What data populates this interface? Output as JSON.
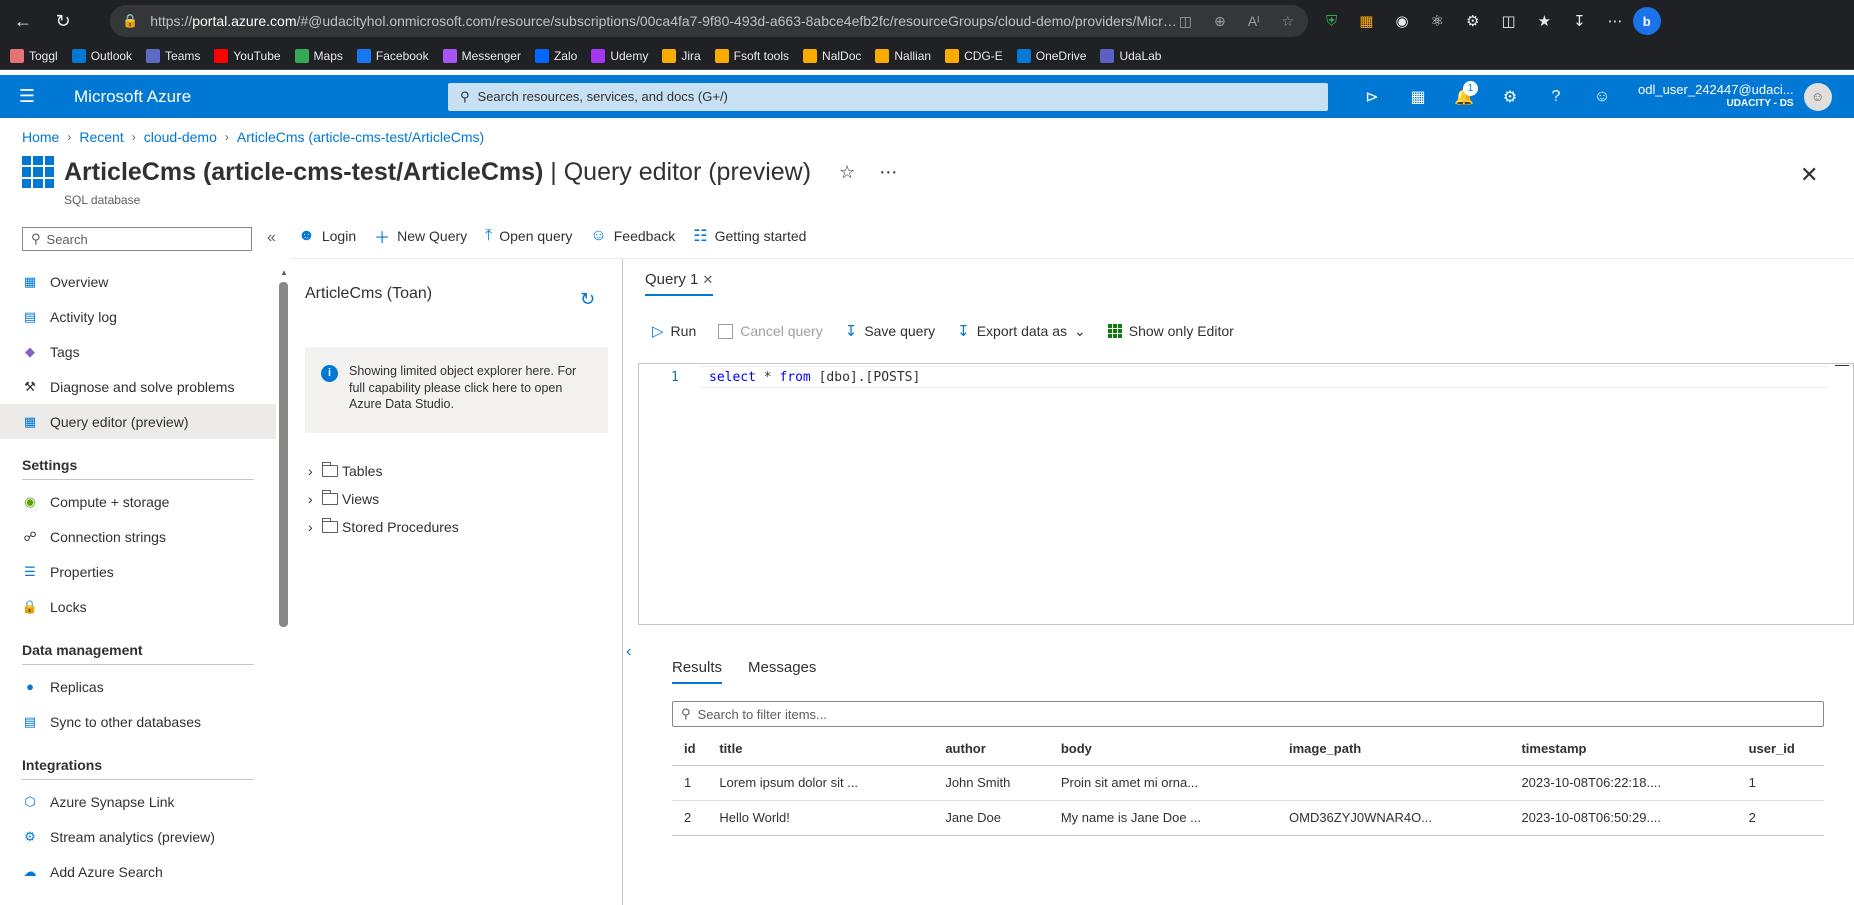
{
  "browser": {
    "url_prefix": "https://",
    "url_host": "portal.azure.com",
    "url_rest": "/#@udacityhol.onmicrosoft.com/resource/subscriptions/00ca4fa7-9f80-493d-a663-8abce4efb2fc/resourceGroups/cloud-demo/providers/Microsoft.Sql/...",
    "bookmarks": [
      "Toggl",
      "Outlook",
      "Teams",
      "YouTube",
      "Maps",
      "Facebook",
      "Messenger",
      "Zalo",
      "Udemy",
      "Jira",
      "Fsoft tools",
      "NalDoc",
      "Nallian",
      "CDG-E",
      "OneDrive",
      "UdaLab"
    ]
  },
  "azure": {
    "brand": "Microsoft Azure",
    "search_placeholder": "Search resources, services, and docs (G+/)",
    "notification_count": "1",
    "user_name": "odl_user_242447@udaci...",
    "user_org": "UDACITY - DS"
  },
  "breadcrumb": [
    "Home",
    "Recent",
    "cloud-demo",
    "ArticleCms (article-cms-test/ArticleCms)"
  ],
  "page": {
    "title_bold": "ArticleCms (article-cms-test/ArticleCms)",
    "title_light": " | Query editor (preview)",
    "subtitle": "SQL database"
  },
  "left_nav": {
    "search_placeholder": "Search",
    "items_top": [
      "Overview",
      "Activity log",
      "Tags",
      "Diagnose and solve problems",
      "Query editor (preview)"
    ],
    "section_settings": "Settings",
    "items_settings": [
      "Compute + storage",
      "Connection strings",
      "Properties",
      "Locks"
    ],
    "section_data": "Data management",
    "items_data": [
      "Replicas",
      "Sync to other databases"
    ],
    "section_integrations": "Integrations",
    "items_integrations": [
      "Azure Synapse Link",
      "Stream analytics (preview)",
      "Add Azure Search"
    ]
  },
  "command_bar": [
    "Login",
    "New Query",
    "Open query",
    "Feedback",
    "Getting started"
  ],
  "object_explorer": {
    "title": "ArticleCms (Toan)",
    "info": "Showing limited object explorer here. For full capability please click here to open Azure Data Studio.",
    "tree": [
      "Tables",
      "Views",
      "Stored Procedures"
    ]
  },
  "query": {
    "tab_label": "Query 1",
    "commands": [
      "Run",
      "Cancel query",
      "Save query",
      "Export data as",
      "Show only Editor"
    ],
    "line_number": "1",
    "code_keyword1": "select",
    "code_mid": " * ",
    "code_keyword2": "from",
    "code_rest": " [dbo].[POSTS]"
  },
  "results": {
    "tabs": [
      "Results",
      "Messages"
    ],
    "filter_placeholder": "Search to filter items...",
    "columns": [
      "id",
      "title",
      "author",
      "body",
      "image_path",
      "timestamp",
      "user_id"
    ],
    "rows": [
      [
        "1",
        "Lorem ipsum dolor sit ...",
        "John Smith",
        "Proin sit amet mi orna...",
        "",
        "2023-10-08T06:22:18....",
        "1"
      ],
      [
        "2",
        "Hello World!",
        "Jane Doe",
        "My name is Jane Doe ...",
        "OMD36ZYJ0WNAR4O...",
        "2023-10-08T06:50:29....",
        "2"
      ]
    ]
  },
  "colors": {
    "azure_blue": "#0078d4",
    "header_search": "#c7e0f4"
  }
}
